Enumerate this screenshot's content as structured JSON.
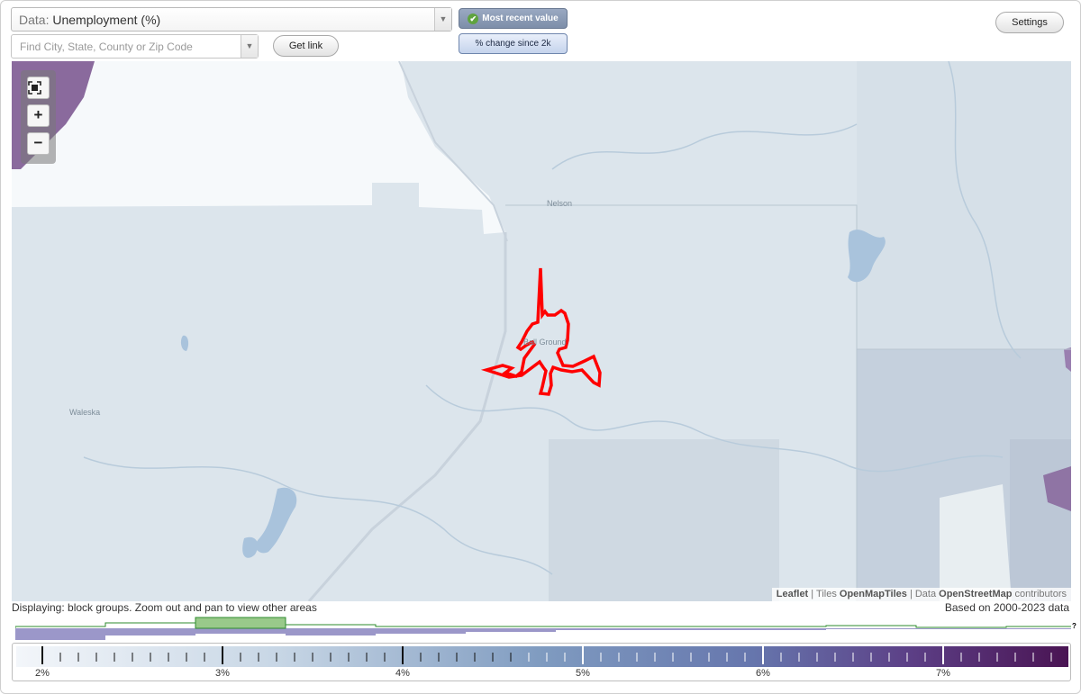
{
  "header": {
    "data_prefix": "Data: ",
    "data_value": "Unemployment (%)",
    "search_placeholder": "Find City, State, County or Zip Code",
    "get_link_label": "Get link",
    "mode_active_label": "Most recent value",
    "mode_inactive_label": "% change since 2k",
    "settings_label": "Settings"
  },
  "map": {
    "labels": [
      "Nelson",
      "Ball Ground",
      "Waleska"
    ],
    "attribution": {
      "leaflet": "Leaflet",
      "tiles_prefix": "| Tiles",
      "tiles": "OpenMapTiles",
      "data_prefix": "| Data",
      "data": "OpenStreetMap",
      "suffix": "contributors"
    },
    "zoom_icons": [
      "fullscreen-icon",
      "zoom-in-icon",
      "zoom-out-icon"
    ],
    "highlight_color": "#ff0000",
    "base_color": "#dce5ec"
  },
  "footer": {
    "display_note": "Displaying: block groups. Zoom out and pan to view other areas",
    "based_on": "Based on 2000-2023 data",
    "help_mark": "?"
  },
  "legend": {
    "tick_labels": [
      "2%",
      "3%",
      "4%",
      "5%",
      "6%",
      "7%"
    ],
    "color_low": "#f3f6fa",
    "color_high": "#4a1453"
  }
}
